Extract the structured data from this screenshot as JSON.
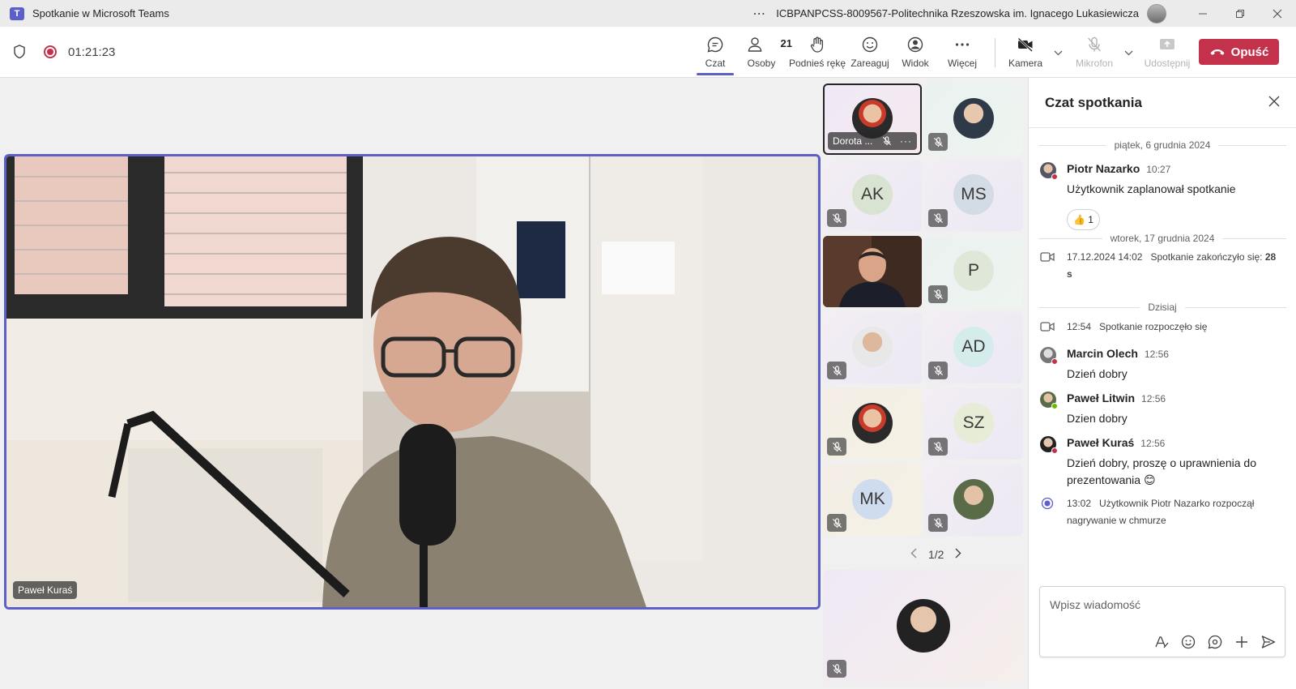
{
  "window": {
    "title": "Spotkanie w Microsoft Teams",
    "org": "ICBPANPCSS-8009567-Politechnika Rzeszowska im. Ignacego Lukasiewicza",
    "more": "⋯"
  },
  "meeting": {
    "timer": "01:21:23",
    "tools": {
      "chat": "Czat",
      "people": "Osoby",
      "people_count": "21",
      "raise_hand": "Podnieś rękę",
      "react": "Zareaguj",
      "view": "Widok",
      "more": "Więcej",
      "camera": "Kamera",
      "mic": "Mikrofon",
      "share": "Udostępnij",
      "leave": "Opuść"
    }
  },
  "stage": {
    "main_speaker": "Paweł Kuraś"
  },
  "gallery": {
    "tiles": [
      {
        "name": "Dorota ...",
        "more": "···"
      },
      {
        "initials": ""
      },
      {
        "initials": "AK"
      },
      {
        "initials": "MS"
      },
      {
        "initials": ""
      },
      {
        "initials": "P"
      },
      {
        "initials": ""
      },
      {
        "initials": "AD"
      },
      {
        "initials": ""
      },
      {
        "initials": "SZ"
      },
      {
        "initials": "MK"
      },
      {
        "initials": ""
      }
    ],
    "pager": "1/2"
  },
  "chat": {
    "title": "Czat spotkania",
    "days": [
      "piątek, 6 grudnia 2024",
      "wtorek, 17 grudnia 2024",
      "Dzisiaj"
    ],
    "messages": [
      {
        "author": "Piotr Nazarko",
        "time": "10:27",
        "text": "Użytkownik zaplanował spotkanie",
        "reaction": "👍 1"
      },
      {
        "author": "Marcin Olech",
        "time": "12:56",
        "text": "Dzień dobry"
      },
      {
        "author": "Paweł Litwin",
        "time": "12:56",
        "text": "Dzien dobry"
      },
      {
        "author": "Paweł Kuraś",
        "time": "12:56",
        "text": "Dzień dobry, proszę o uprawnienia do prezentowania 😊"
      }
    ],
    "system": [
      {
        "time": "17.12.2024 14:02",
        "text": "Spotkanie zakończyło się:",
        "bold": "28 s"
      },
      {
        "time": "12:54",
        "text": "Spotkanie rozpoczęło się"
      },
      {
        "time": "13:02",
        "text": "Użytkownik Piotr Nazarko rozpoczął nagrywanie w chmurze"
      }
    ],
    "compose_placeholder": "Wpisz wiadomość"
  },
  "colors": {
    "accent": "#5b5fc7",
    "leave": "#c4314b",
    "recording": "#c4314b"
  }
}
